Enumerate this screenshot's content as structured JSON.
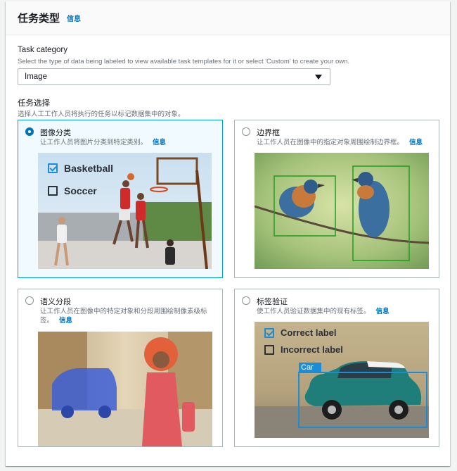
{
  "header": {
    "title": "任务类型",
    "info": "信息"
  },
  "task_category": {
    "label": "Task category",
    "description": "Select the type of data being labeled to view available task templates for it or select 'Custom' to create your own.",
    "selected": "Image"
  },
  "task_selection": {
    "label": "任务选择",
    "description": "选择人工工作人员将执行的任务以标记数据集中的对象。"
  },
  "cards": [
    {
      "title": "图像分类",
      "description": "让工作人员将图片分类到特定类别。",
      "info": "信息",
      "selected": true,
      "image_labels": [
        "Basketball",
        "Soccer"
      ],
      "image_checked": [
        true,
        false
      ]
    },
    {
      "title": "边界框",
      "description": "让工作人员在图像中的指定对象周围绘制边界框。",
      "info": "信息",
      "selected": false,
      "box_color": "#1f9d1f"
    },
    {
      "title": "语义分段",
      "description": "让工作人员在图像中的特定对象和分段周围绘制像素级标签。",
      "info": "信息",
      "selected": false,
      "mask_color": "#3d5fd6"
    },
    {
      "title": "标签验证",
      "description": "使工作人员验证数据集中的现有标签。",
      "info": "信息",
      "selected": false,
      "image_labels": [
        "Correct label",
        "Incorrect label"
      ],
      "image_checked": [
        true,
        false
      ],
      "box_tag": "Car",
      "box_color": "#1a8dd6"
    }
  ],
  "colors": {
    "accent": "#0073bb",
    "selected_border": "#00a1c9"
  }
}
